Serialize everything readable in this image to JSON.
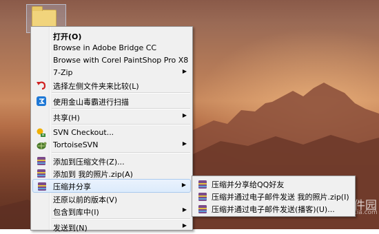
{
  "context_menu": {
    "items": [
      {
        "label": "打开(O)",
        "icon": "none"
      },
      {
        "label": "Browse in Adobe Bridge CC",
        "icon": "none"
      },
      {
        "label": "Browse with Corel PaintShop Pro X8",
        "icon": "none"
      },
      {
        "label": "7-Zip",
        "icon": "none",
        "submenu": true
      },
      {
        "label": "选择左侧文件夹来比较(L)",
        "icon": "undo-arrow-icon"
      },
      {
        "label": "使用金山毒霸进行扫描",
        "icon": "jinshan-duba-icon"
      },
      {
        "label": "共享(H)",
        "icon": "none",
        "submenu": true
      },
      {
        "label": "SVN Checkout...",
        "icon": "svn-checkout-icon"
      },
      {
        "label": "TortoiseSVN",
        "icon": "tortoisesvn-icon",
        "submenu": true
      },
      {
        "label": "添加到压缩文件(Z)...",
        "icon": "winrar-archive-icon"
      },
      {
        "label": "添加到 我的照片.zip(A)",
        "icon": "winrar-archive-icon"
      },
      {
        "label": "压缩并分享",
        "icon": "winrar-archive-icon",
        "submenu": true
      },
      {
        "label": "还原以前的版本(V)",
        "icon": "none"
      },
      {
        "label": "包含到库中(I)",
        "icon": "none",
        "submenu": true
      },
      {
        "label": "发送到(N)",
        "icon": "none",
        "submenu": true
      }
    ],
    "submenu_arrow": "▶"
  },
  "submenu": {
    "items": [
      {
        "label": "压缩并分享给QQ好友",
        "icon": "winrar-archive-icon"
      },
      {
        "label": "压缩并通过电子邮件发送 我的照片.zip(I)",
        "icon": "winrar-archive-icon"
      },
      {
        "label": "压缩并通过电子邮件发送(播客)(U)...",
        "icon": "winrar-archive-icon"
      }
    ]
  },
  "watermark": {
    "text": "当下软件园",
    "subtext": "www.downxia.com"
  },
  "colors": {
    "menu_bg": "#f0f0f0",
    "highlight": "#dcebfc",
    "highlight_border": "#a9c9ee"
  }
}
